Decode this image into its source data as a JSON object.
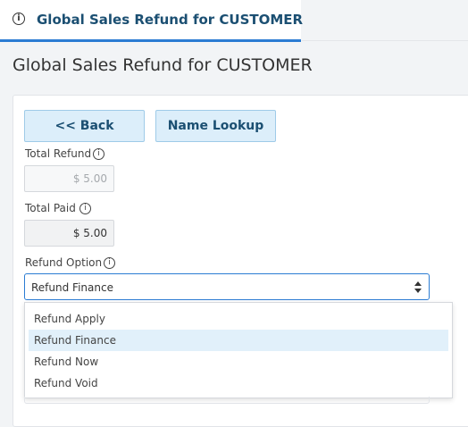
{
  "tab": {
    "title": "Global Sales Refund for CUSTOMER",
    "icon": "info-icon"
  },
  "page": {
    "title": "Global Sales Refund for CUSTOMER"
  },
  "toolbar": {
    "back_label": "<< Back",
    "lookup_label": "Name Lookup"
  },
  "form": {
    "total_refund": {
      "label": "Total Refund",
      "value": "$ 5.00"
    },
    "total_paid": {
      "label": "Total Paid",
      "value": "$ 5.00"
    },
    "refund_option": {
      "label": "Refund Option",
      "selected": "Refund Finance",
      "options": [
        "Refund Apply",
        "Refund Finance",
        "Refund Now",
        "Refund Void"
      ]
    }
  },
  "colors": {
    "accent": "#2b7cd3",
    "button_bg": "#dceefa",
    "button_text": "#1b4f72",
    "selected_option_bg": "#e1f0fa"
  }
}
